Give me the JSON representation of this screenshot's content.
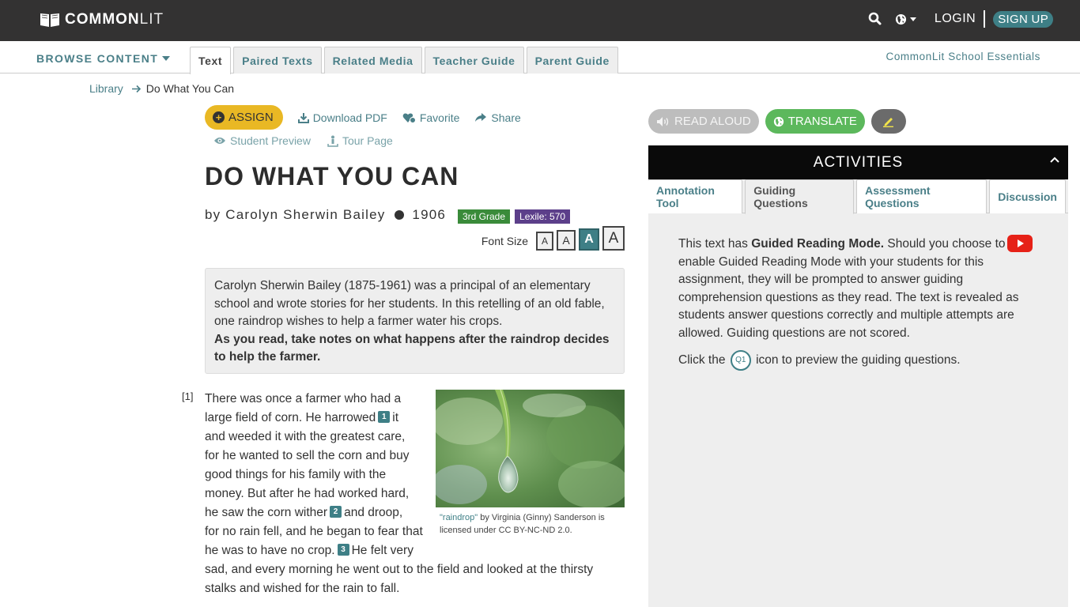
{
  "topbar": {
    "brand_bold": "COMMON",
    "brand_light": "LIT",
    "search_icon": "search-icon",
    "language_icon": "globe-icon",
    "login_label": "LOGIN",
    "signup_label": "SIGN UP"
  },
  "subnav": {
    "browse_label": "BROWSE CONTENT",
    "tabs": [
      {
        "label": "Text",
        "active": true
      },
      {
        "label": "Paired Texts",
        "active": false
      },
      {
        "label": "Related Media",
        "active": false
      },
      {
        "label": "Teacher Guide",
        "active": false
      },
      {
        "label": "Parent Guide",
        "active": false
      }
    ],
    "essentials_label": "CommonLit School Essentials"
  },
  "breadcrumb": {
    "library": "Library",
    "current": "Do What You Can"
  },
  "actions": {
    "assign": "ASSIGN",
    "download_pdf": "Download PDF",
    "favorite": "Favorite",
    "share": "Share",
    "student_preview": "Student Preview",
    "tour_page": "Tour Page"
  },
  "text": {
    "title": "DO WHAT YOU CAN",
    "author": "by Carolyn Sherwin Bailey",
    "year": "1906",
    "grade_badge": "3rd Grade",
    "lexile_badge": "Lexile: 570",
    "font_size_label": "Font Size",
    "font_size_options": [
      "A",
      "A",
      "A",
      "A"
    ],
    "font_size_selected": 3,
    "intro": "Carolyn Sherwin Bailey (1875-1961) was a principal of an elementary school and wrote stories for her students. In this retelling of an old fable, one raindrop wishes to help a farmer water his crops.",
    "intro_prompt": "As you read, take notes on what happens after the raindrop decides to help the farmer.",
    "paragraph_number": "[1]",
    "body_lines": [
      "There was once a farmer who had a",
      "large field of corn. He harrowed",
      "it",
      "and weeded it with the greatest care,",
      "for he wanted to sell the corn and buy",
      "good things for his family with the",
      "money. But after he had worked hard,",
      "he saw the corn wither",
      "and droop,",
      "for no rain fell, and he began to fear that",
      "he was to have no crop.",
      "He felt very",
      "sad, and every morning he went out to the field and looked at the thirsty",
      "stalks and wished for the rain to fall."
    ],
    "footnotes": [
      "1",
      "2",
      "3"
    ],
    "image_caption_link": "\"raindrop\"",
    "image_caption_rest": " by Virginia (Ginny) Sanderson is licensed under CC BY-NC-ND 2.0."
  },
  "tools": {
    "read_aloud": "READ ALOUD",
    "translate": "TRANSLATE",
    "highlighter_icon": "pencil-icon"
  },
  "activities": {
    "header": "ACTIVITIES",
    "tabs": [
      {
        "label": "Annotation Tool",
        "active": false
      },
      {
        "label": "Guiding Questions",
        "active": true
      },
      {
        "label": "Assessment Questions",
        "active": false
      },
      {
        "label": "Discussion",
        "active": false
      }
    ],
    "guided_intro": "This text has ",
    "guided_bold": "Guided Reading Mode.",
    "guided_rest": " Should you choose to enable Guided Reading Mode with your students for this assignment, they will be prompted to answer guiding comprehension questions as they read. The text is revealed as students answer questions correctly and multiple attempts are allowed. Guiding questions are not scored.",
    "click_prefix": "Click the",
    "q1_label": "Q1",
    "click_suffix": "icon to preview the guiding questions."
  },
  "colors": {
    "topbar": "#333232",
    "accent_teal": "#3e7f86",
    "link_teal": "#4a7f88",
    "assign_yellow": "#e9b824",
    "translate_green": "#5cb85c",
    "grade_green": "#3a8b3a",
    "lexile_purple": "#5c3f8a"
  }
}
